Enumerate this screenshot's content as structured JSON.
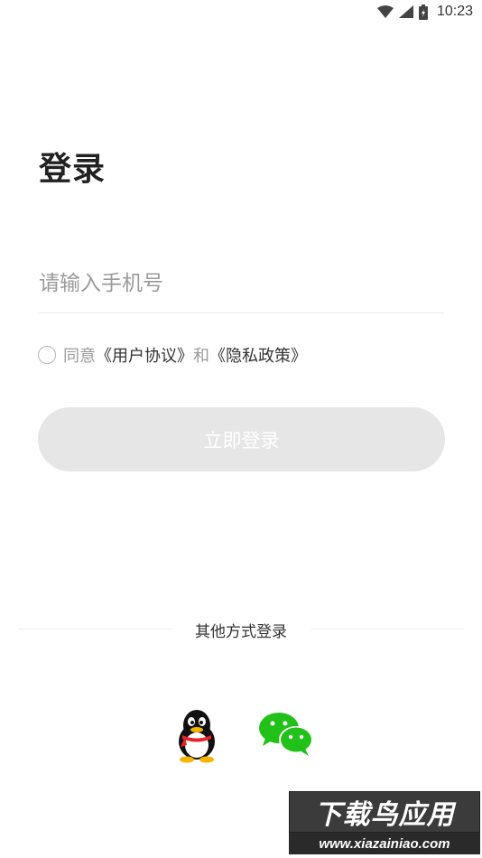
{
  "status_bar": {
    "time": "10:23",
    "icons": [
      "wifi-icon",
      "cell-signal-icon",
      "battery-icon"
    ]
  },
  "login": {
    "title": "登录",
    "phone_placeholder": "请输入手机号",
    "agreement": {
      "prefix": "同意",
      "user_agreement": "《用户协议》",
      "conjunction": "和",
      "privacy_policy": "《隐私政策》"
    },
    "submit_label": "立即登录"
  },
  "other_login": {
    "label": "其他方式登录",
    "options": [
      "qq-icon",
      "wechat-icon"
    ]
  },
  "watermark": {
    "title": "下载鸟应用",
    "url": "www.xiazainiao.com"
  },
  "colors": {
    "button_disabled_bg": "#e6e6e6",
    "placeholder": "#9a9a9a",
    "text_primary": "#222222",
    "wechat_green": "#22c11a"
  }
}
